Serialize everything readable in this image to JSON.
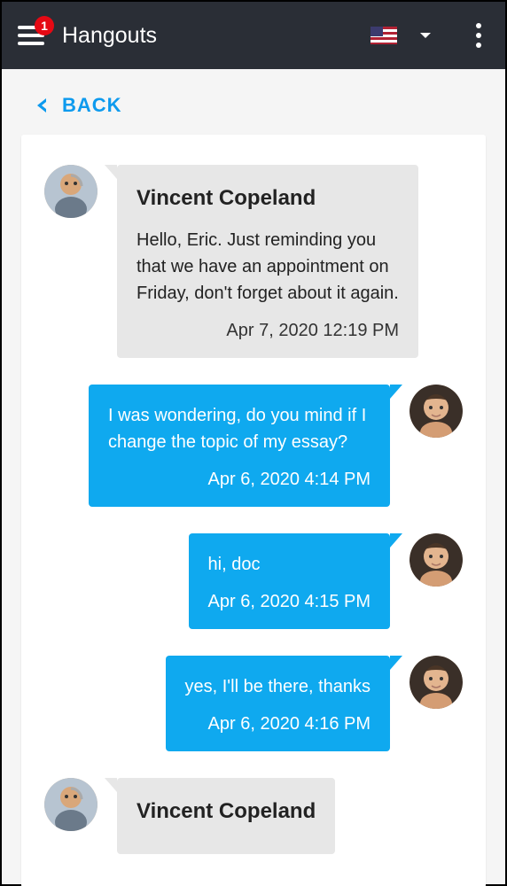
{
  "header": {
    "title": "Hangouts",
    "badge_count": "1"
  },
  "nav": {
    "back_label": "BACK"
  },
  "messages": [
    {
      "side": "other",
      "sender": "Vincent Copeland",
      "text": "Hello, Eric. Just reminding you that we have an appointment on Friday, don't forget about it again.",
      "time": "Apr 7, 2020 12:19 PM"
    },
    {
      "side": "self",
      "text": "I was wondering, do you mind if I change the topic of my essay?",
      "time": "Apr 6, 2020 4:14 PM"
    },
    {
      "side": "self",
      "text": "hi, doc",
      "time": "Apr 6, 2020 4:15 PM"
    },
    {
      "side": "self",
      "text": "yes, I'll be there, thanks",
      "time": "Apr 6, 2020 4:16 PM"
    },
    {
      "side": "other",
      "sender": "Vincent Copeland",
      "text": "",
      "time": ""
    }
  ]
}
